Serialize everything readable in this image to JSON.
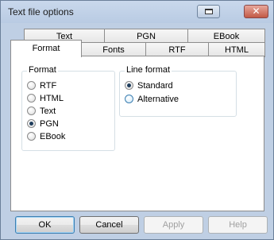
{
  "window": {
    "title": "Text file options"
  },
  "tabs": {
    "row_back": [
      "Text",
      "PGN",
      "EBook"
    ],
    "row_front": [
      "Format",
      "Fonts",
      "RTF",
      "HTML"
    ],
    "active": "Format"
  },
  "format_group": {
    "label": "Format",
    "options": [
      "RTF",
      "HTML",
      "Text",
      "PGN",
      "EBook"
    ],
    "selected": "PGN"
  },
  "line_format_group": {
    "label": "Line format",
    "options": [
      "Standard",
      "Alternative"
    ],
    "selected": "Standard"
  },
  "buttons": {
    "ok": "OK",
    "cancel": "Cancel",
    "apply": "Apply",
    "help": "Help"
  }
}
